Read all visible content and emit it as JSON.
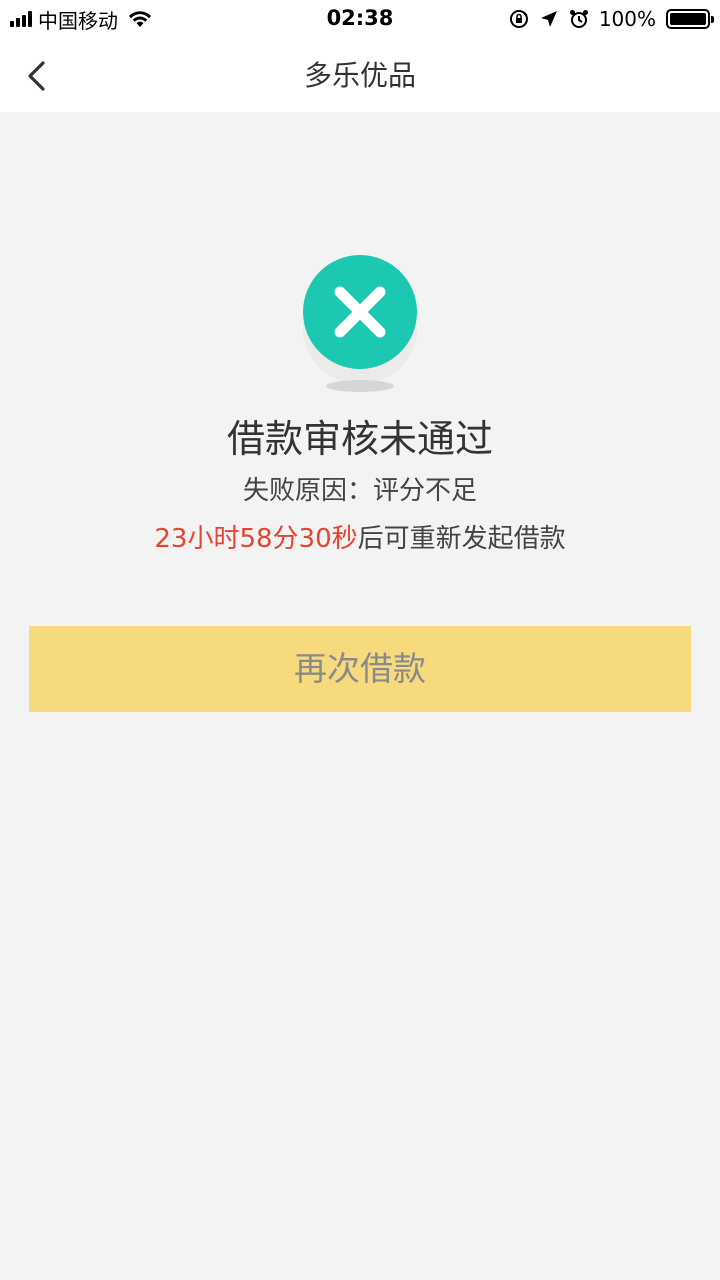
{
  "status_bar": {
    "carrier": "中国移动",
    "time": "02:38",
    "battery_percent": "100%",
    "icons": [
      "signal-icon",
      "wifi-icon",
      "rotation-lock-icon",
      "location-arrow-icon",
      "alarm-icon",
      "battery-icon"
    ]
  },
  "nav": {
    "title": "多乐优品",
    "back_icon": "chevron-left-icon"
  },
  "result": {
    "icon": "close-circle-icon",
    "icon_color": "#1cc8b0",
    "title": "借款审核未通过",
    "reason": "失败原因：评分不足",
    "countdown": "23小时58分30秒",
    "countdown_suffix": "后可重新发起借款",
    "countdown_color": "#e8432f"
  },
  "retry_button": {
    "label": "再次借款",
    "background": "#f8da7e"
  }
}
